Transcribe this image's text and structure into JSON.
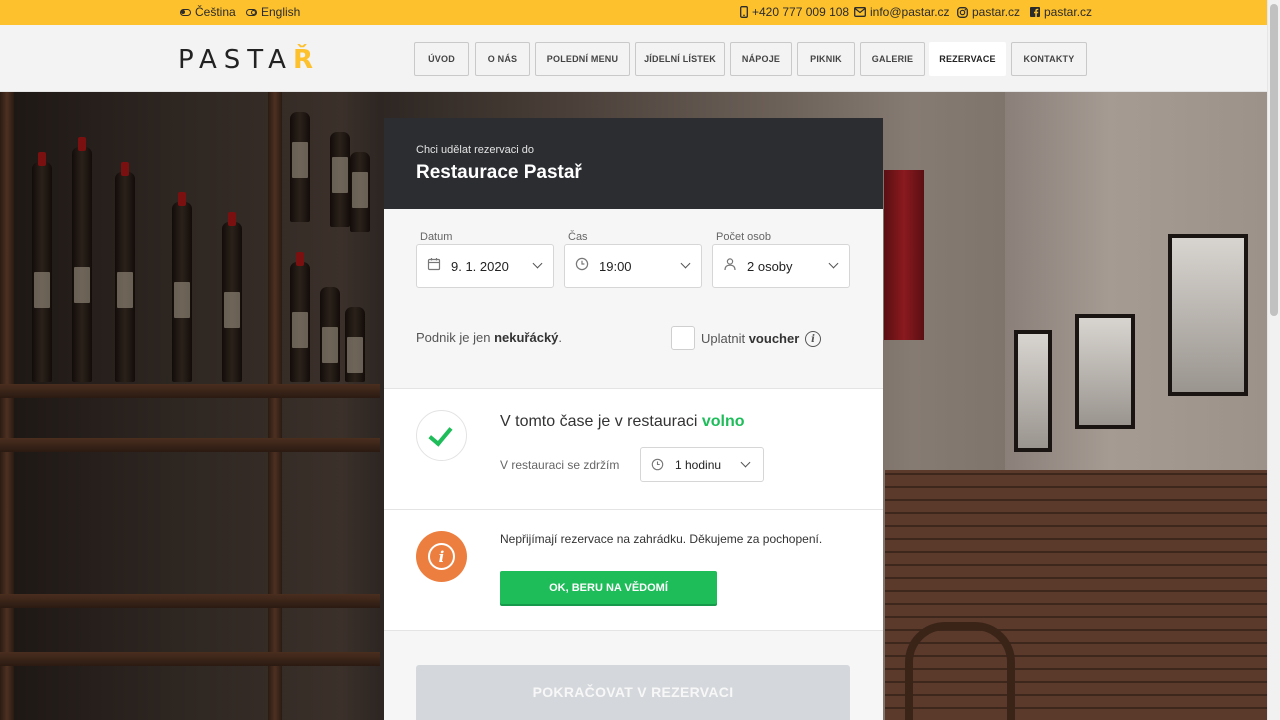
{
  "topbar": {
    "lang_cs": "Čeština",
    "lang_en": "English",
    "phone": "+420 777 009 108",
    "email": "info@pastar.cz",
    "instagram": "pastar.cz",
    "facebook": "pastar.cz"
  },
  "logo": {
    "text": "PASTA",
    "accent": "Ř"
  },
  "nav": {
    "items": [
      {
        "label": "ÚVOD"
      },
      {
        "label": "O NÁS"
      },
      {
        "label": "POLEDNÍ MENU"
      },
      {
        "label": "JÍDELNÍ LÍSTEK"
      },
      {
        "label": "NÁPOJE"
      },
      {
        "label": "PIKNIK"
      },
      {
        "label": "GALERIE"
      },
      {
        "label": "REZERVACE"
      },
      {
        "label": "KONTAKTY"
      }
    ],
    "active": "REZERVACE"
  },
  "reservation": {
    "subtitle": "Chci udělat rezervaci do",
    "restaurant": "Restaurace Pastař",
    "date": {
      "label": "Datum",
      "value": "9. 1. 2020"
    },
    "time": {
      "label": "Čas",
      "value": "19:00"
    },
    "persons": {
      "label": "Počet osob",
      "value": "2 osoby"
    },
    "smoking_prefix": "Podnik je jen",
    "smoking_value": "nekuřácký",
    "smoking_suffix": ".",
    "voucher_prefix": "Uplatnit",
    "voucher_bold": "voucher",
    "availability_prefix": "V tomto čase je v restauraci",
    "availability_status": "volno",
    "stay_label": "V restauraci se zdržím",
    "stay_value": "1 hodinu",
    "notice": "Nepřijímají rezervace na zahrádku. Děkujeme za pochopení.",
    "ack_button": "OK, BERU NA VĚDOMÍ",
    "continue_button": "POKRAČOVAT V REZERVACI"
  },
  "colors": {
    "brand_yellow": "#fdc12e",
    "ok_green": "#1ebd5a",
    "info_orange": "#ec7f3f",
    "header_dark": "#2b2d31"
  },
  "icons": {
    "date": "calendar-icon",
    "time": "clock-icon",
    "persons": "person-icon",
    "voucher_help": "info-icon",
    "available": "check-icon",
    "notice": "info-icon"
  }
}
